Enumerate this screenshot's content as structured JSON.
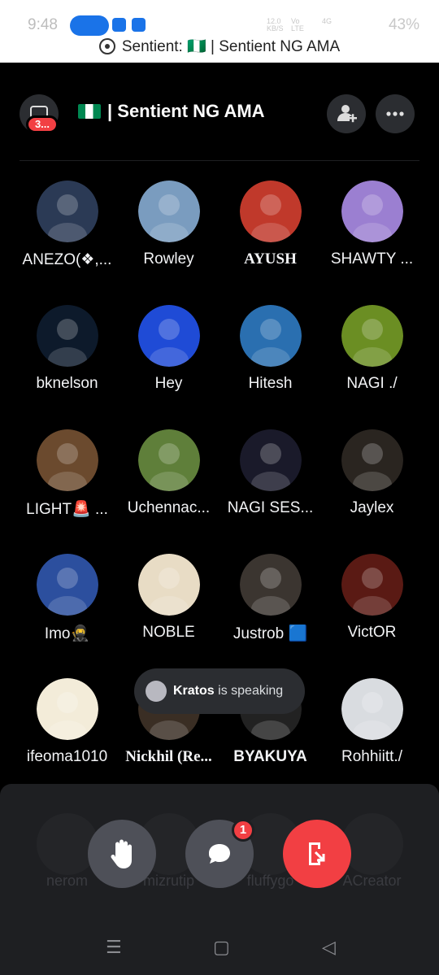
{
  "status_bar": {
    "time": "9:48",
    "net_speed": "12.0",
    "net_unit": "KB/S",
    "volte": "Vo LTE",
    "net": "4G",
    "battery": "43%"
  },
  "banner": {
    "text": "Sentient: 🇳🇬 | Sentient NG AMA"
  },
  "header": {
    "title": "| Sentient NG AMA",
    "badge": "3..."
  },
  "participants": [
    {
      "name": "ANEZO(❖,...",
      "color": "#2b3a55"
    },
    {
      "name": "Rowley",
      "color": "#7a9cbf"
    },
    {
      "name": "AYUSH",
      "color": "#c0392b",
      "serif": true
    },
    {
      "name": "SHAWTY ...",
      "color": "#9b7fd1"
    },
    {
      "name": "bknelson",
      "color": "#0d1a2b"
    },
    {
      "name": "Hey",
      "color": "#1f4bd6"
    },
    {
      "name": "Hitesh",
      "color": "#2a6fb0"
    },
    {
      "name": "NAGI ./",
      "color": "#6b8e23"
    },
    {
      "name": "LIGHT🚨 ...",
      "color": "#6b4a2e"
    },
    {
      "name": "Uchennac...",
      "color": "#5f7f3a"
    },
    {
      "name": "NAGI SES...",
      "color": "#1a1a2a"
    },
    {
      "name": "Jaylex",
      "color": "#2a2520"
    },
    {
      "name": "Imo🥷",
      "color": "#2c4f9e"
    },
    {
      "name": "NOBLE",
      "color": "#e8dcc5"
    },
    {
      "name": "Justrob 🟦",
      "color": "#3b3530"
    },
    {
      "name": "VictOR",
      "color": "#5a1a14"
    },
    {
      "name": "ifeoma1010",
      "color": "#f3ecd9"
    },
    {
      "name": "Nickhil (Re...",
      "color": "#3a2e24",
      "serif": true
    },
    {
      "name": "BYAKUYA",
      "color": "#222",
      "bold": true
    },
    {
      "name": "Rohhiitt./",
      "color": "#d9dce0"
    }
  ],
  "toast": {
    "speaker": "Kratos",
    "text": "is speaking"
  },
  "hidden_row": [
    "nerom",
    "mizrutip",
    "fluffygo",
    "ACreator"
  ],
  "controls": {
    "chat_badge": "1"
  },
  "nav": {
    "recents": "☰",
    "home": "▢",
    "back": "◁"
  }
}
